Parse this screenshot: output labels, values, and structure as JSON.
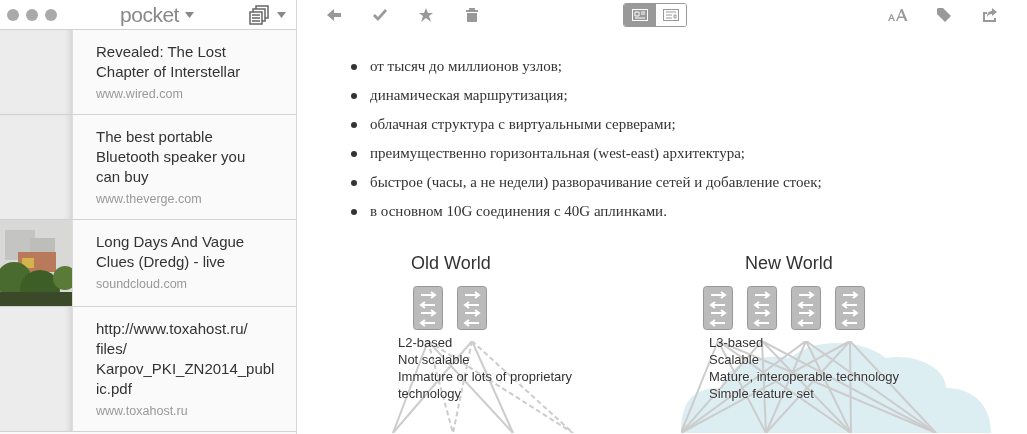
{
  "sidebar": {
    "title": "pocket",
    "items": [
      {
        "title": "Revealed: The Lost Chapter of Interstellar",
        "source": "www.wired.com",
        "thumbnail": false
      },
      {
        "title": "The best portable Bluetooth speaker you can buy",
        "source": "www.theverge.com",
        "thumbnail": false
      },
      {
        "title": "Long Days And Vague Clues (Dredg) - live",
        "source": "soundcloud.com",
        "thumbnail": true
      },
      {
        "title": "http://www.toxahost.ru/ files/ Karpov_PKI_ZN2014_publ ic.pdf",
        "source": "www.toxahost.ru",
        "thumbnail": false
      }
    ]
  },
  "toolbar": {
    "view_modes": [
      {
        "kind": "article",
        "selected": true
      },
      {
        "kind": "web",
        "selected": false
      }
    ]
  },
  "article": {
    "bullets": [
      "от тысяч до миллионов узлов;",
      "динамическая маршрутизация;",
      "облачная структура с виртуальными серверами;",
      "преимущественно горизонтальная (west-east) архитектура;",
      "быстрое (часы, а не недели) разворачивание сетей и добавление стоек;",
      "в основном 10G соединения с 40G аплинками."
    ],
    "figure": {
      "panels": [
        {
          "title": "Old World",
          "lines": [
            "L2-based",
            "Not scalable",
            "Immature or lots of proprietary technology"
          ]
        },
        {
          "title": "New World",
          "lines": [
            "L3-based",
            "Scalable",
            "Mature, interoperable technology",
            "Simple feature set"
          ]
        }
      ]
    }
  }
}
